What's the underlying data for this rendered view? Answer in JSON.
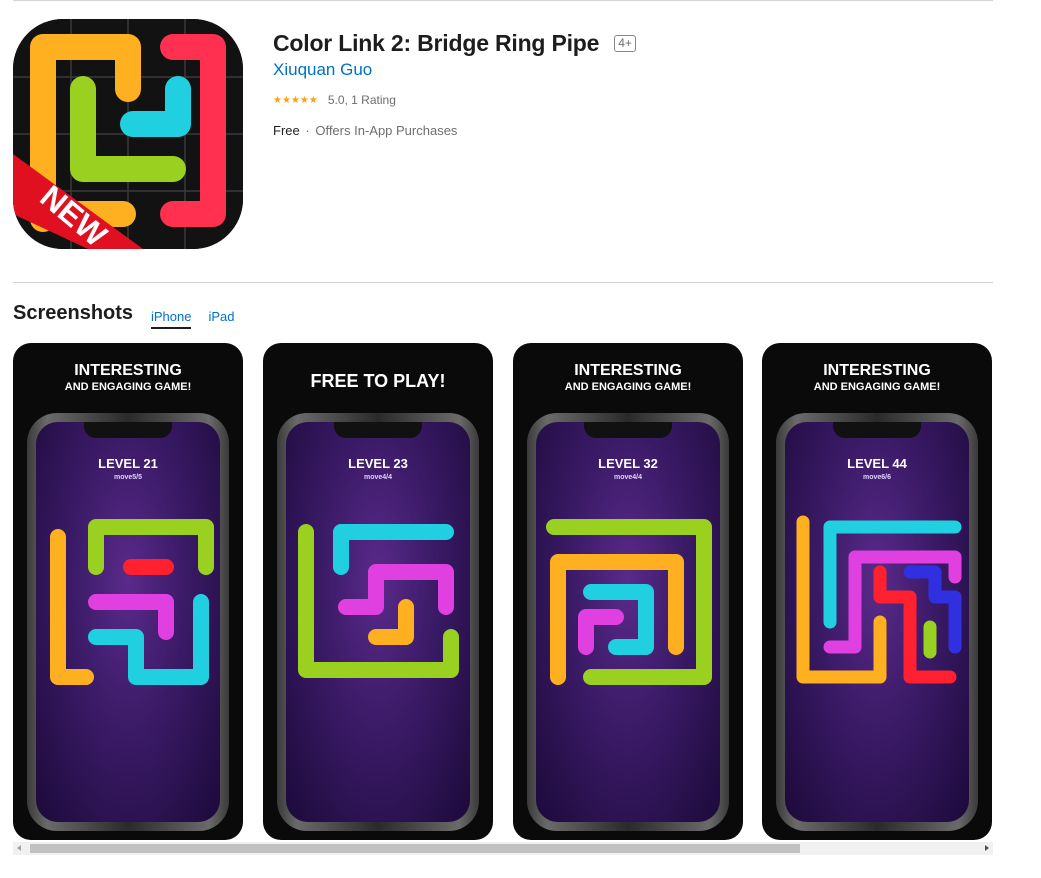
{
  "app": {
    "title": "Color Link 2: Bridge Ring Pipe",
    "age_rating": "4+",
    "developer": "Xiuquan Guo",
    "stars": "★★★★★",
    "rating_text": "5.0, 1 Rating",
    "price": "Free",
    "separator": "·",
    "in_app": "Offers In-App Purchases",
    "icon_badge": "NEW"
  },
  "screenshots": {
    "heading": "Screenshots",
    "tabs": [
      {
        "label": "iPhone",
        "active": true
      },
      {
        "label": "iPad",
        "active": false
      }
    ],
    "items": [
      {
        "caption_main": "INTERESTING",
        "caption_sub": "AND ENGAGING GAME!",
        "level": "LEVEL 21",
        "moves": "move5/5"
      },
      {
        "caption_main": "FREE TO PLAY!",
        "caption_sub": "",
        "level": "LEVEL 23",
        "moves": "move4/4"
      },
      {
        "caption_main": "INTERESTING",
        "caption_sub": "AND ENGAGING GAME!",
        "level": "LEVEL 32",
        "moves": "move4/4"
      },
      {
        "caption_main": "INTERESTING",
        "caption_sub": "AND ENGAGING GAME!",
        "level": "LEVEL 44",
        "moves": "move6/6"
      }
    ]
  },
  "colors": {
    "link": "#0070c9",
    "star": "#ff9f0a",
    "pipe_yellow": "#ffb020",
    "pipe_green": "#9ad020",
    "pipe_red": "#ff3050",
    "pipe_cyan": "#20d0e0",
    "pipe_magenta": "#e040e0",
    "pipe_blue": "#3030e0"
  },
  "icons": {
    "scroll_left": "scroll-left-arrow-icon",
    "scroll_right": "scroll-right-arrow-icon"
  }
}
